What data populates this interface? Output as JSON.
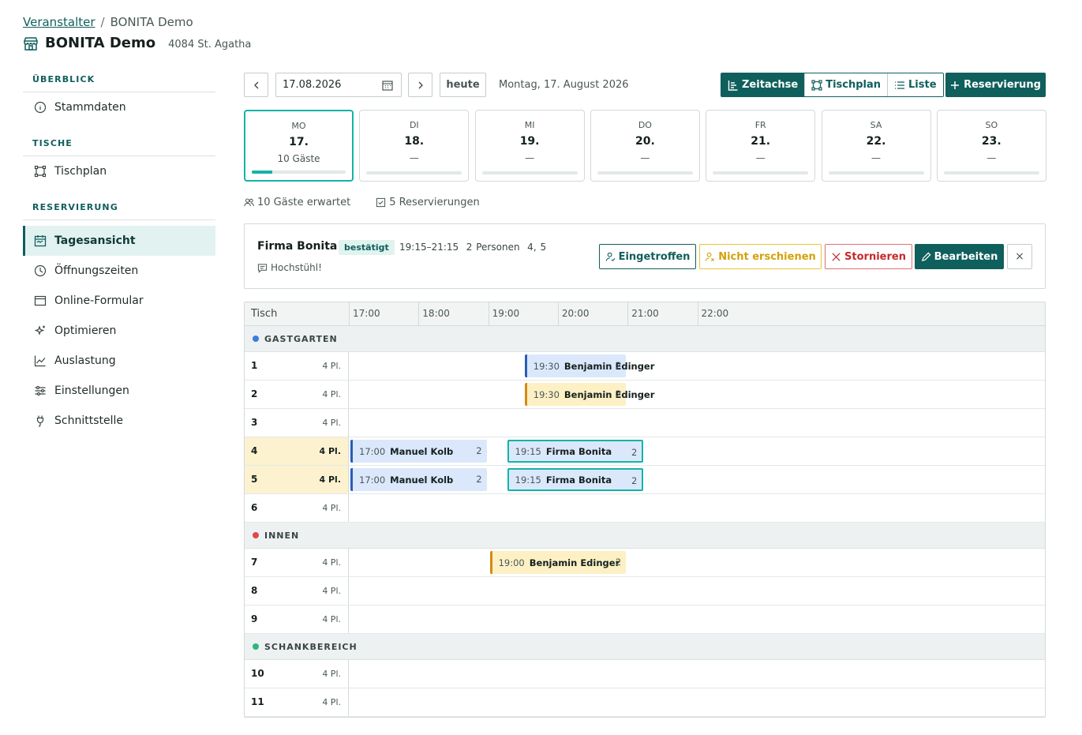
{
  "breadcrumb": {
    "parent": "Veranstalter",
    "current": "BONITA Demo"
  },
  "header": {
    "title": "BONITA Demo",
    "address": "4084 St. Agatha"
  },
  "sidebar": {
    "sections": [
      {
        "title": "ÜBERBLICK",
        "items": [
          {
            "label": "Stammdaten",
            "icon": "info-icon"
          }
        ]
      },
      {
        "title": "TISCHE",
        "items": [
          {
            "label": "Tischplan",
            "icon": "table-layout-icon"
          }
        ]
      },
      {
        "title": "RESERVIERUNG",
        "items": [
          {
            "label": "Tagesansicht",
            "icon": "calendar-icon",
            "active": true
          },
          {
            "label": "Öffnungszeiten",
            "icon": "clock-icon"
          },
          {
            "label": "Online-Formular",
            "icon": "browser-icon"
          },
          {
            "label": "Optimieren",
            "icon": "sparkle-icon"
          },
          {
            "label": "Auslastung",
            "icon": "chart-icon"
          },
          {
            "label": "Einstellungen",
            "icon": "sliders-icon"
          },
          {
            "label": "Schnittstelle",
            "icon": "plug-icon"
          }
        ]
      }
    ]
  },
  "toolbar": {
    "date_value": "17.08.2026",
    "today_label": "heute",
    "long_date": "Montag, 17. August 2026",
    "views": [
      "Zeitachse",
      "Tischplan",
      "Liste"
    ],
    "new_reservation": "Reservierung"
  },
  "week": [
    {
      "dow": "MO",
      "date": "17.",
      "guests": "10 Gäste",
      "fill": 0.22,
      "active": true
    },
    {
      "dow": "DI",
      "date": "18.",
      "guests": "—",
      "fill": 0
    },
    {
      "dow": "MI",
      "date": "19.",
      "guests": "—",
      "fill": 0
    },
    {
      "dow": "DO",
      "date": "20.",
      "guests": "—",
      "fill": 0
    },
    {
      "dow": "FR",
      "date": "21.",
      "guests": "—",
      "fill": 0
    },
    {
      "dow": "SA",
      "date": "22.",
      "guests": "—",
      "fill": 0
    },
    {
      "dow": "SO",
      "date": "23.",
      "guests": "—",
      "fill": 0
    }
  ],
  "stats": {
    "guests": "10 Gäste erwartet",
    "reservations": "5 Reservierungen"
  },
  "detail": {
    "name": "Firma Bonita",
    "status": "bestätigt",
    "meta": "19:15–21:15  2 Personen  4, 5",
    "note": "Hochstühl!",
    "actions": {
      "arrived": "Eingetroffen",
      "noshow": "Nicht erschienen",
      "cancel": "Stornieren",
      "edit": "Bearbeiten",
      "close": "×"
    }
  },
  "timeline": {
    "col_header": "Tisch",
    "hours": [
      "17:00",
      "18:00",
      "19:00",
      "20:00",
      "21:00",
      "22:00"
    ],
    "groups": [
      {
        "name": "GASTGARTEN",
        "color": "#3b7ddd",
        "tables": [
          {
            "no": "1",
            "seats": "4 Pl.",
            "res": [
              {
                "time": "19:30",
                "name": "Benjamin Edinger",
                "pax": "2",
                "style": "blue",
                "start": "19:30",
                "end": "21:00"
              }
            ]
          },
          {
            "no": "2",
            "seats": "4 Pl.",
            "res": [
              {
                "time": "19:30",
                "name": "Benjamin Edinger",
                "pax": "2",
                "style": "yellow",
                "start": "19:30",
                "end": "21:00"
              }
            ]
          },
          {
            "no": "3",
            "seats": "4 Pl.",
            "res": []
          },
          {
            "no": "4",
            "seats": "4 Pl.",
            "highlight": true,
            "res": [
              {
                "time": "17:00",
                "name": "Manuel Kolb",
                "pax": "2",
                "style": "blue",
                "start": "17:00",
                "end": "19:00"
              },
              {
                "time": "19:15",
                "name": "Firma Bonita",
                "pax": "2",
                "style": "sel",
                "start": "19:15",
                "end": "21:15"
              }
            ]
          },
          {
            "no": "5",
            "seats": "4 Pl.",
            "highlight": true,
            "res": [
              {
                "time": "17:00",
                "name": "Manuel Kolb",
                "pax": "2",
                "style": "blue",
                "start": "17:00",
                "end": "19:00"
              },
              {
                "time": "19:15",
                "name": "Firma Bonita",
                "pax": "2",
                "style": "sel",
                "start": "19:15",
                "end": "21:15"
              }
            ]
          },
          {
            "no": "6",
            "seats": "4 Pl.",
            "res": []
          }
        ]
      },
      {
        "name": "INNEN",
        "color": "#e04848",
        "tables": [
          {
            "no": "7",
            "seats": "4 Pl.",
            "res": [
              {
                "time": "19:00",
                "name": "Benjamin Edinger",
                "pax": "2",
                "style": "yellow",
                "start": "19:00",
                "end": "21:00"
              }
            ]
          },
          {
            "no": "8",
            "seats": "4 Pl.",
            "res": []
          },
          {
            "no": "9",
            "seats": "4 Pl.",
            "res": []
          }
        ]
      },
      {
        "name": "SCHANKBEREICH",
        "color": "#2fb67c",
        "tables": [
          {
            "no": "10",
            "seats": "4 Pl.",
            "res": []
          },
          {
            "no": "11",
            "seats": "4 Pl.",
            "res": []
          }
        ]
      }
    ]
  }
}
